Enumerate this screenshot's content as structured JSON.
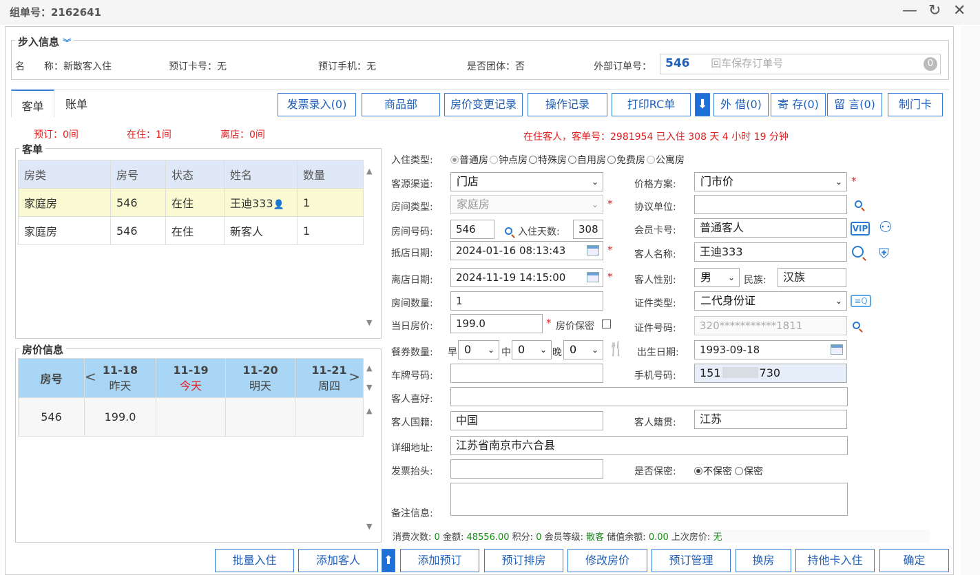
{
  "window": {
    "title": "组单号：2162641"
  },
  "step_info": {
    "legend": "步入信息",
    "name_label": "名　　称：",
    "name": "新散客入住",
    "card_label": "预订卡号：",
    "card": "无",
    "phone_label": "预订手机：",
    "phone": "无",
    "group_label": "是否团体：",
    "group": "否",
    "ext_label": "外部订单号：",
    "ext_value": "546",
    "ext_placeholder": "回车保存订单号",
    "ext_badge": "0"
  },
  "tabs": [
    "客单",
    "账单"
  ],
  "toolbar": [
    "发票录入(0)",
    "商品部",
    "房价变更记录",
    "操作记录",
    "打印RC单",
    "外 借(0)",
    "寄 存(0)",
    "留 言(0)",
    "制门卡"
  ],
  "counts": {
    "reserved": "预订：0间",
    "inhouse": "在住：1间",
    "left": "离店：0间"
  },
  "status_line": "在住客人，客单号：2981954 已入住 308 天 4 小时 19 分钟",
  "orders": {
    "legend": "客单",
    "headers": [
      "房类",
      "房号",
      "状态",
      "姓名",
      "数量"
    ],
    "rows": [
      [
        "家庭房",
        "546",
        "在住",
        "王迪333",
        "1"
      ],
      [
        "家庭房",
        "546",
        "在住",
        "新客人",
        "1"
      ]
    ]
  },
  "rates": {
    "legend": "房价信息",
    "header_room": "房号",
    "days": [
      {
        "date": "11-18",
        "day": "昨天"
      },
      {
        "date": "11-19",
        "day": "今天"
      },
      {
        "date": "11-20",
        "day": "明天"
      },
      {
        "date": "11-21",
        "day": "周四"
      }
    ],
    "rows": [
      [
        "546",
        "199.0",
        "",
        "",
        ""
      ]
    ]
  },
  "form": {
    "checkin_type_label": "入住类型:",
    "checkin_types": [
      "普通房",
      "钟点房",
      "特殊房",
      "自用房",
      "免费房",
      "公寓房"
    ],
    "source_label": "客源渠道:",
    "source": "门店",
    "price_plan_label": "价格方案:",
    "price_plan": "门市价",
    "room_type_label": "房间类型:",
    "room_type": "家庭房",
    "agreement_label": "协议单位:",
    "agreement": "",
    "room_no_label": "房间号码:",
    "room_no": "546",
    "days_label": "入住天数:",
    "days": "308",
    "member_label": "会员卡号:",
    "member": "普通客人",
    "arrive_label": "抵店日期:",
    "arrive": "2024-01-16 08:13:43",
    "guest_label": "客人名称:",
    "guest": "王迪333",
    "depart_label": "离店日期:",
    "depart": "2024-11-19 14:15:00",
    "gender_label": "客人性别:",
    "gender": "男",
    "ethnic_label": "民族:",
    "ethnic": "汉族",
    "rooms_label": "房间数量:",
    "rooms": "1",
    "id_type_label": "证件类型:",
    "id_type": "二代身份证",
    "price_label": "当日房价:",
    "price": "199.0",
    "price_secret_label": "房价保密",
    "id_no_label": "证件号码:",
    "id_no": "320***********1811",
    "meal_label": "餐券数量:",
    "meal_b": "早",
    "meal_b_val": "0",
    "meal_l": "中",
    "meal_l_val": "0",
    "meal_d": "晚",
    "meal_d_val": "0",
    "birth_label": "出生日期:",
    "birth": "1993-09-18",
    "plate_label": "车牌号码:",
    "plate": "",
    "mobile_label": "手机号码:",
    "mobile_a": "151",
    "mobile_b": "730",
    "hobby_label": "客人喜好:",
    "hobby": "",
    "nation_label": "客人国籍:",
    "nation": "中国",
    "native_label": "客人籍贯:",
    "native": "江苏",
    "address_label": "详细地址:",
    "address": "江苏省南京市六合县",
    "invoice_label": "发票抬头:",
    "invoice": "",
    "secret_label": "是否保密:",
    "secret_no": "不保密",
    "secret_yes": "保密",
    "remark_label": "备注信息:",
    "remark": "",
    "vip": "VIP"
  },
  "stats": {
    "count_label": "消费次数:",
    "count": "0",
    "amount_label": "金额:",
    "amount": "48556.00",
    "points_label": "积分:",
    "points": "0",
    "level_label": "会员等级:",
    "level": "散客",
    "balance_label": "储值余额:",
    "balance": "0.00",
    "last_label": "上次房价:",
    "last": "无"
  },
  "bottom_buttons": [
    "批量入住",
    "添加客人",
    "添加预订",
    "预订排房",
    "修改房价",
    "预订管理",
    "换房",
    "持他卡入住",
    "确定"
  ]
}
